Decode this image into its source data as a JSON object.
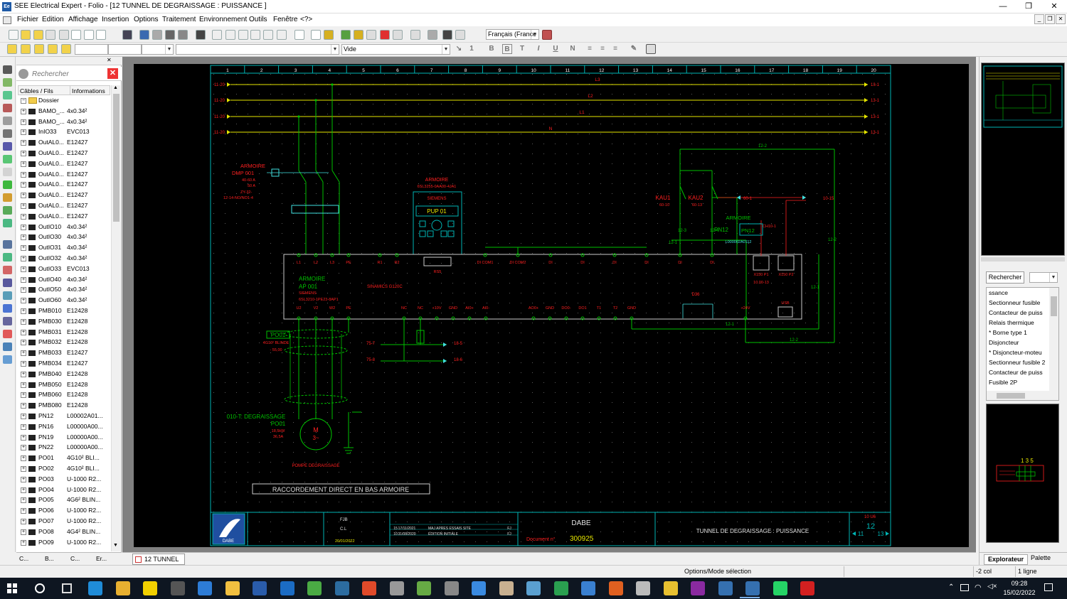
{
  "window": {
    "app_icon": "Ee",
    "title": "SEE Electrical Expert - Folio - [12 TUNNEL DE DEGRAISSAGE : PUISSANCE ]",
    "minimize": "—",
    "restore": "❐",
    "close": "✕"
  },
  "menu": [
    "Fichier",
    "Edition",
    "Affichage",
    "Insertion",
    "Options",
    "Traitement",
    "Environnement",
    "Outils",
    "Fenêtre",
    "<?>"
  ],
  "toolbar": {
    "language": "Français (France",
    "style_combo": "Vide",
    "size_field": "1",
    "format_buttons": [
      "B",
      "B",
      "T",
      "I",
      "U",
      "N"
    ]
  },
  "explorer": {
    "search_placeholder": "Rechercher",
    "col_cables": "Câbles / Fils",
    "col_info": "Informations",
    "root": "Dossier",
    "rows": [
      [
        "BAMO_...",
        "4x0.34²"
      ],
      [
        "BAMO_...",
        "4x0.34²"
      ],
      [
        "InIO33",
        "EVC013"
      ],
      [
        "OutAL0...",
        "E12427"
      ],
      [
        "OutAL0...",
        "E12427"
      ],
      [
        "OutAL0...",
        "E12427"
      ],
      [
        "OutAL0...",
        "E12427"
      ],
      [
        "OutAL0...",
        "E12427"
      ],
      [
        "OutAL0...",
        "E12427"
      ],
      [
        "OutAL0...",
        "E12427"
      ],
      [
        "OutAL0...",
        "E12427"
      ],
      [
        "OutIO10",
        "4x0.34²"
      ],
      [
        "OutIO30",
        "4x0.34²"
      ],
      [
        "OutIO31",
        "4x0.34²"
      ],
      [
        "OutIO32",
        "4x0.34²"
      ],
      [
        "OutIO33",
        "EVC013"
      ],
      [
        "OutIO40",
        "4x0.34²"
      ],
      [
        "OutIO50",
        "4x0.34²"
      ],
      [
        "OutIO60",
        "4x0.34²"
      ],
      [
        "PMB010",
        "E12428"
      ],
      [
        "PMB030",
        "E12428"
      ],
      [
        "PMB031",
        "E12428"
      ],
      [
        "PMB032",
        "E12428"
      ],
      [
        "PMB033",
        "E12427"
      ],
      [
        "PMB034",
        "E12427"
      ],
      [
        "PMB040",
        "E12428"
      ],
      [
        "PMB050",
        "E12428"
      ],
      [
        "PMB060",
        "E12428"
      ],
      [
        "PMB080",
        "E12428"
      ],
      [
        "PN12",
        "L00002A01..."
      ],
      [
        "PN16",
        "L00000A00..."
      ],
      [
        "PN19",
        "L00000A00..."
      ],
      [
        "PN22",
        "L00000A00..."
      ],
      [
        "PO01",
        "4G10² BLI..."
      ],
      [
        "PO02",
        "4G10² BLI..."
      ],
      [
        "PO03",
        "U-1000 R2..."
      ],
      [
        "PO04",
        "U-1000 R2..."
      ],
      [
        "PO05",
        "4G6² BLIN..."
      ],
      [
        "PO06",
        "U-1000 R2..."
      ],
      [
        "PO07",
        "U-1000 R2..."
      ],
      [
        "PO08",
        "4G4² BLIN..."
      ],
      [
        "PO09",
        "U-1000 R2..."
      ]
    ],
    "bottom_tabs": [
      "C...",
      "B...",
      "C...",
      "Er..."
    ]
  },
  "document_tab": "12 TUNNEL ...",
  "schematic": {
    "columns": [
      "1",
      "2",
      "3",
      "4",
      "5",
      "6",
      "7",
      "8",
      "9",
      "10",
      "11",
      "12",
      "13",
      "14",
      "15",
      "16",
      "17",
      "18",
      "19",
      "20"
    ],
    "bus_labels_left": [
      "11-20",
      "11-20",
      "11-20",
      "11-20"
    ],
    "bus_labels_right": [
      "13-1",
      "13-1",
      "13-1",
      "13-1"
    ],
    "bus_names": [
      "L3",
      "L2",
      "L1",
      "N"
    ],
    "dmp": [
      "ARMOIRE",
      "DMP 001",
      "40-60 A",
      "50 A",
      "ZY-32-",
      "12-14-NO/NO1-4"
    ],
    "pup": [
      "ARMOIRE",
      "6SL3255-0AA00-4JA1",
      "SIEMENS",
      "PUP 01"
    ],
    "vfd": [
      "ARMOIRE",
      "AP 001",
      "SIEMENS",
      "6SL3210-1PE23-8AP1",
      "SINAMICS G120C"
    ],
    "vfd_top_terminals": [
      "L1",
      "L2",
      "L3",
      "PE",
      "R1",
      "R2",
      "DI COM1",
      "DI COM2",
      "DI",
      "DI",
      "DI",
      "DI",
      "DI",
      "DI"
    ],
    "vfd_bottom_terminals": [
      "U2",
      "V2",
      "W2",
      "PE",
      "NC",
      "NC",
      "+10V",
      "GND",
      "AI0+",
      "AI0-",
      "AO0+",
      "GND",
      "DO0-",
      "DO1",
      "T1",
      "T2",
      "GND",
      "+24V"
    ],
    "sub_labels": [
      "RS5",
      "D36",
      "USB",
      "X150 P1",
      "X150 P2",
      "10.00-13"
    ],
    "kau": [
      "KAU1",
      "KAU2",
      "60-10",
      "60-13"
    ],
    "pn12": [
      "ARMOIRE",
      "PN12",
      "PN12",
      "L000002A0112",
      "CH10-1"
    ],
    "cross_refs": [
      "12-2",
      "12-3",
      "12-4",
      "12-1",
      "12-1",
      "12-1",
      "12-2",
      "12-2",
      "60-1",
      "10-15",
      "18-5",
      "18-6",
      "75-7",
      "75-8"
    ],
    "motor": [
      "PO01",
      "4G10² BLINDE",
      "- 55,00",
      "010-T: DEGRAISSAGE",
      "PO01",
      "18,5kW",
      "36,5A",
      "M",
      "3~",
      "POMPE DEGRAISSAGE"
    ],
    "note": "RACCORDEMENT DIRECT EN BAS ARMOIRE",
    "cartouche": {
      "company": "DABE",
      "doc_label": "Document n°",
      "doc_number": "300925",
      "folio_title": "TUNNEL DE DEGRAISSAGE : PUISSANCE",
      "revisions": [
        [
          "15",
          "17/11/2021",
          "MAJ APRES ESSAIS SITE",
          "FJ"
        ],
        [
          "10",
          "31/08/2020",
          "EDITION INITIALE",
          "FJ"
        ]
      ],
      "folio": "12",
      "prev": "11",
      "next": "13",
      "folio_top": "10 U6",
      "drawn": "FJB",
      "checked": "C.L",
      "date": "20/01/2022"
    }
  },
  "right_panel": {
    "search_button": "Rechercher",
    "items": [
      "ssance",
      "Sectionneur fusible",
      "Contacteur de puiss",
      "Relais thermique",
      "* Borne type 1",
      "Disjoncteur",
      "* Disjoncteur-moteu",
      "Sectionneur fusible 2",
      "Contacteur de puiss",
      "Fusible 2P"
    ],
    "preview_label": "1 3 5",
    "tabs": [
      "Explorateur",
      "Palette"
    ]
  },
  "status": {
    "mode": "Options/Mode sélection",
    "cols": "-2 col",
    "lines": "1 ligne"
  },
  "taskbar": {
    "clock_time": "09:28",
    "clock_date": "15/02/2022"
  },
  "colors": {
    "border": "#00b4b4",
    "green": "#00c000",
    "yellow": "#e6e600",
    "red": "#ff2020",
    "cyan": "#40e0e0"
  }
}
